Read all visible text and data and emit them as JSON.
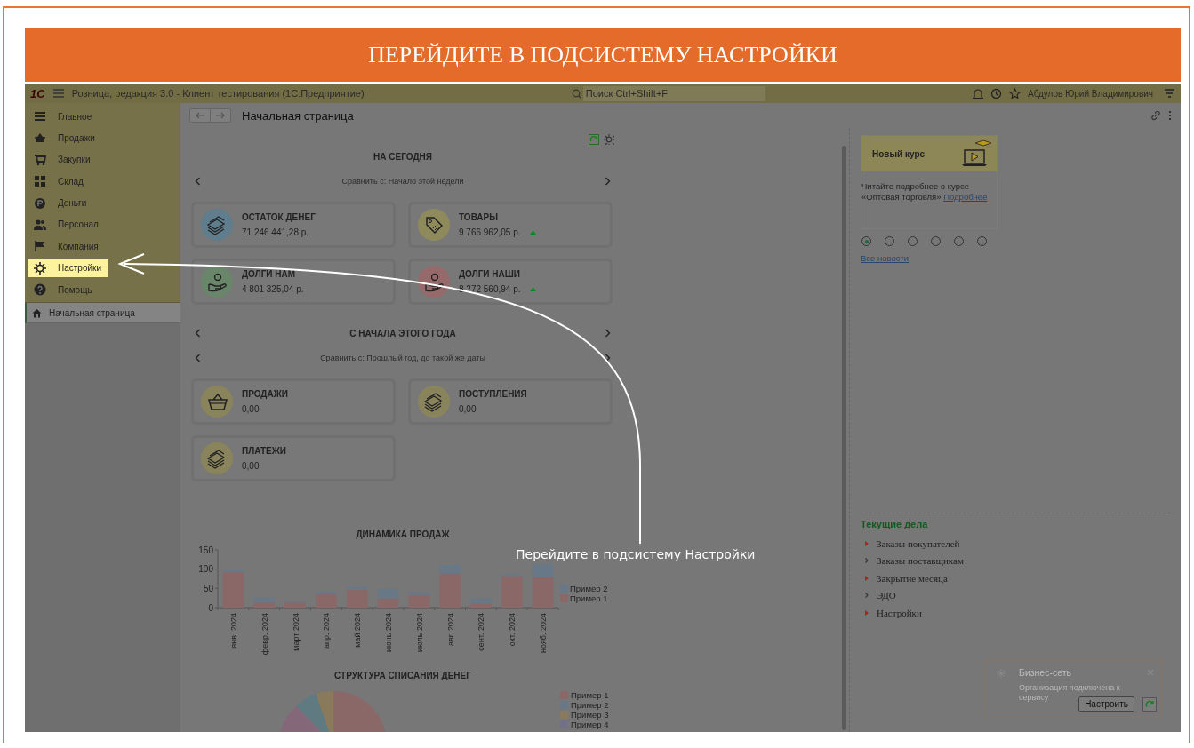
{
  "tutorial": {
    "title": "ПЕРЕЙДИТЕ В ПОДСИСТЕМУ НАСТРОЙКИ",
    "hint": "Перейдите в подсистему Настройки"
  },
  "app_bar": {
    "logo": "1С",
    "title": "Розница, редакция 3.0  - Клиент тестирования (1С:Предприятие)",
    "search": {
      "placeholder": "Поиск Ctrl+Shift+F"
    },
    "user": "Абдулов Юрий Владимирович"
  },
  "sidebar": {
    "items": [
      {
        "label": "Главное",
        "kind": "list",
        "selected": false
      },
      {
        "label": "Продажи",
        "kind": "basket",
        "selected": false
      },
      {
        "label": "Закупки",
        "kind": "cart",
        "selected": false
      },
      {
        "label": "Склад",
        "kind": "grid",
        "selected": false
      },
      {
        "label": "Деньги",
        "kind": "coin",
        "selected": false
      },
      {
        "label": "Персонал",
        "kind": "people",
        "selected": false
      },
      {
        "label": "Компания",
        "kind": "flag",
        "selected": false
      },
      {
        "label": "Настройки",
        "kind": "gear",
        "selected": true
      },
      {
        "label": "Помощь",
        "kind": "help",
        "selected": false
      }
    ],
    "open_pages": [
      {
        "label": "Начальная страница",
        "selected": true
      }
    ]
  },
  "page": {
    "title": "Начальная страница",
    "sections": [
      {
        "heading": "НА СЕГОДНЯ",
        "heading_arrows": false,
        "compare": "Сравнить с: Начало этой недели",
        "cards": [
          {
            "title": "ОСТАТОК ДЕНЕГ",
            "value": "71 246 441,28 р.",
            "kind": "money",
            "color": "#5f7d8c",
            "trend_up": false
          },
          {
            "title": "ТОВАРЫ",
            "value": "9 766 962,05 р.",
            "kind": "tag",
            "color": "#8e8a5c",
            "trend_up": true
          },
          {
            "title": "ДОЛГИ НАМ",
            "value": "4 801 325,04 р.",
            "kind": "hand",
            "color": "#6a866a",
            "trend_up": false
          },
          {
            "title": "ДОЛГИ НАШИ",
            "value": "8 272 560,94 р.",
            "kind": "hand",
            "color": "#966a6a",
            "trend_up": true
          }
        ]
      },
      {
        "heading": "С НАЧАЛА ЭТОГО ГОДА",
        "heading_arrows": true,
        "compare": "Сравнить с: Прошлый год, до такой же даты",
        "cards": [
          {
            "title": "ПРОДАЖИ",
            "value": "0,00",
            "kind": "basket",
            "color": "#8a845c",
            "trend_up": false
          },
          {
            "title": "ПОСТУПЛЕНИЯ",
            "value": "0,00",
            "kind": "money",
            "color": "#8a845c",
            "trend_up": false
          },
          {
            "title": "ПЛАТЕЖИ",
            "value": "0,00",
            "kind": "money",
            "color": "#8a845c",
            "trend_up": false
          }
        ]
      }
    ],
    "sales_chart": {
      "chart_data": {
        "type": "bar",
        "title": "ДИНАМИКА ПРОДАЖ",
        "stacked": true,
        "categories": [
          "янв. 2024",
          "февр. 2024",
          "март 2024",
          "апр. 2024",
          "май 2024",
          "июнь 2024",
          "июль 2024",
          "авг. 2024",
          "сент. 2024",
          "окт. 2024",
          "нояб. 2024"
        ],
        "series": [
          {
            "name": "Пример 1",
            "color": "#8a6868",
            "values": [
              92,
              13,
              13,
              35,
              46,
              23,
              32,
              88,
              10,
              82,
              80
            ]
          },
          {
            "name": "Пример 2",
            "color": "#687886",
            "values": [
              6,
              14,
              5,
              7,
              8,
              26,
              9,
              22,
              14,
              5,
              33
            ]
          }
        ],
        "ylim": [
          0,
          150
        ],
        "yticks": [
          0,
          50,
          100,
          150
        ],
        "legend": "right"
      }
    },
    "pie_chart": {
      "title": "СТРУКТУРА СПИСАНИЯ ДЕНЕГ",
      "legend": [
        {
          "label": "Пример 1",
          "color": "#8a6868"
        },
        {
          "label": "Пример 2",
          "color": "#687886"
        },
        {
          "label": "Пример 3",
          "color": "#8a7a5c"
        },
        {
          "label": "Пример 4",
          "color": "#75708a"
        }
      ]
    }
  },
  "news": {
    "banner": "Новый курс",
    "text": "Читайте подробнее о курсе «Оптовая торговля»",
    "link": "Подробнее",
    "pages": [
      {
        "selected": true
      },
      {
        "selected": false
      },
      {
        "selected": false
      },
      {
        "selected": false
      },
      {
        "selected": false
      },
      {
        "selected": false
      }
    ],
    "all_link": "Все новости"
  },
  "tasks": {
    "title": "Текущие дела",
    "items": [
      {
        "label": "Заказы покупателей",
        "alert": true
      },
      {
        "label": "Заказы поставщикам",
        "alert": false
      },
      {
        "label": "Закрытие месяца",
        "alert": true
      },
      {
        "label": "ЭДО",
        "alert": false
      },
      {
        "label": "Настройки",
        "alert": true
      }
    ]
  },
  "toast": {
    "title": "Бизнес-сеть",
    "text": "Организация подключена к сервису",
    "button": "Настроить"
  }
}
